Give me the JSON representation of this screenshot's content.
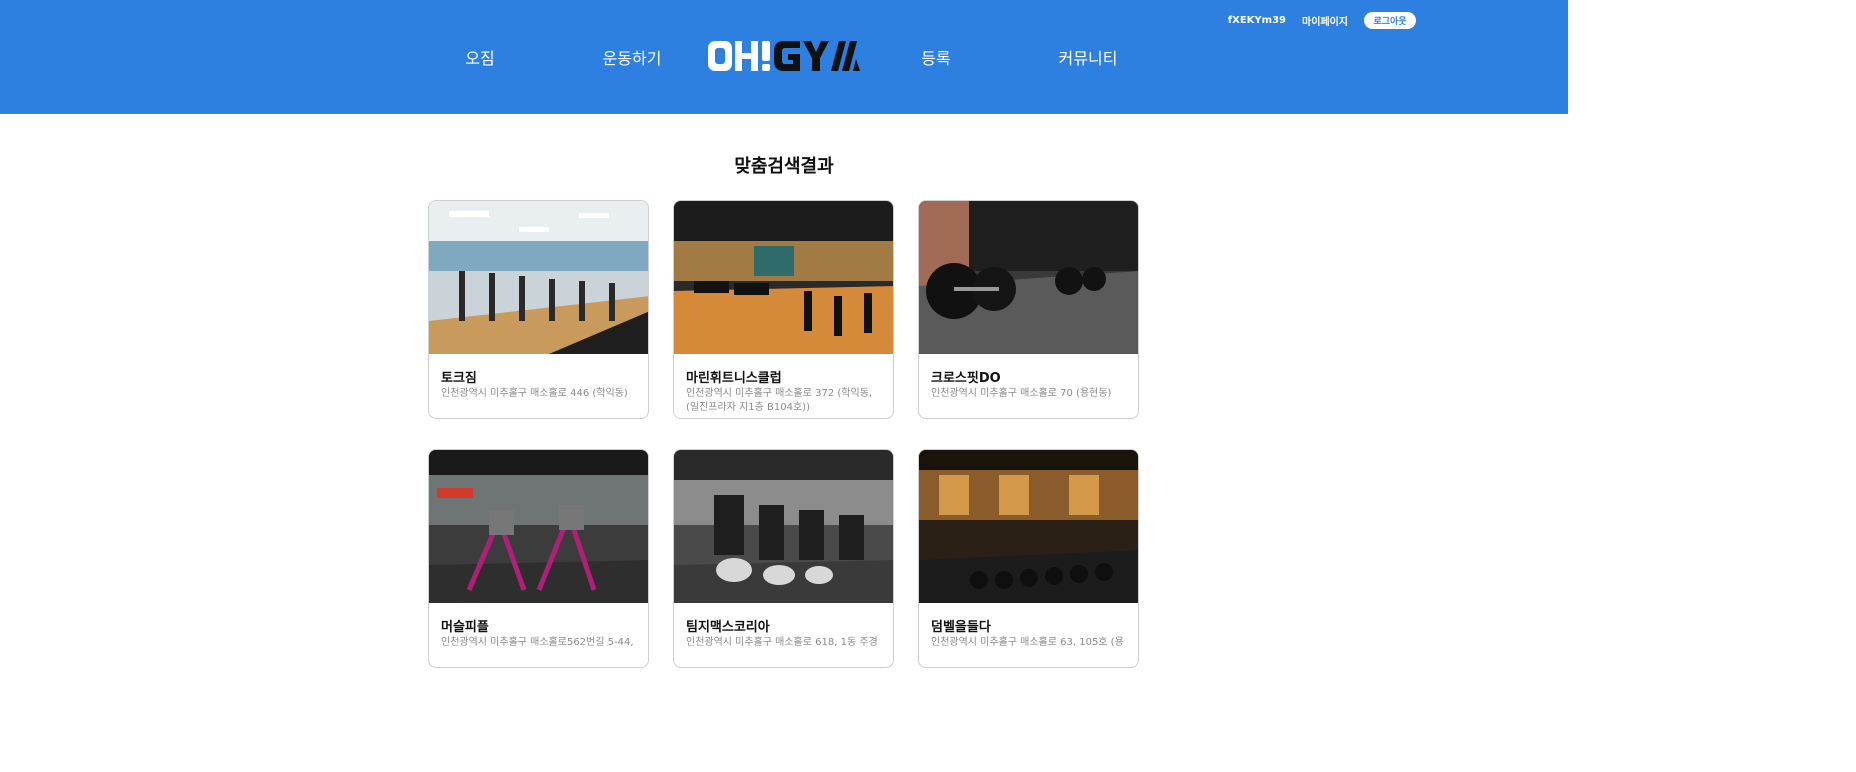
{
  "header": {
    "username": "fXEKYm39",
    "mypage_label": "마이페이지",
    "logout_label": "로그아웃",
    "nav": [
      "오짐",
      "운동하기",
      "등록",
      "커뮤니티"
    ],
    "logo_text": "OH!GYM"
  },
  "main": {
    "title": "맞춤검색결과",
    "gyms": [
      {
        "name": "토크짐",
        "address": "인천광역시 미추홀구 매소홀로 446 (학익동)",
        "image": "cardio-floor"
      },
      {
        "name": "마린휘트니스클럽",
        "address": "인천광역시 미추홀구 매소홀로 372 (학익동,(일진프라자 지1층 B104호))",
        "image": "wood-floor-gym"
      },
      {
        "name": "크로스핏DO",
        "address": "인천광역시 미추홀구 매소홀로 70 (용현동)",
        "image": "barbell-floor"
      },
      {
        "name": "머슬피플",
        "address": "인천광역시 미추홀구 매소홀로562번길 5-44,",
        "image": "stair-machines"
      },
      {
        "name": "팀지맥스코리아",
        "address": "인천광역시 미추홀구 매소홀로 618, 1동 주경",
        "image": "cardio-machines"
      },
      {
        "name": "덤벨을들다",
        "address": "인천광역시 미추홀구 매소홀로 63, 105호 (용",
        "image": "dumbbell-rack"
      }
    ]
  },
  "colors": {
    "header_bg": "#2d7fe0"
  }
}
